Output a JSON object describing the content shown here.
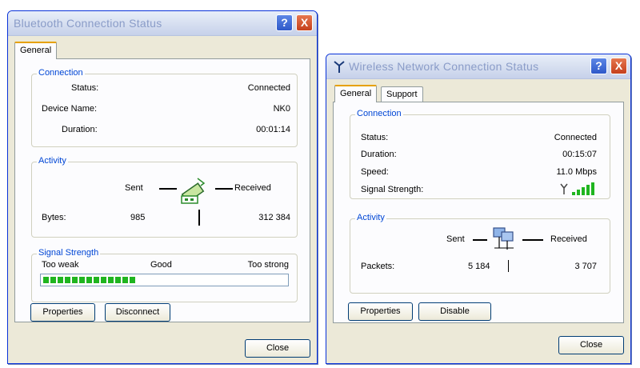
{
  "bt": {
    "title": "Bluetooth Connection Status",
    "tab_general": "General",
    "connection_label": "Connection",
    "status_label": "Status:",
    "status_value": "Connected",
    "device_label": "Device Name:",
    "device_value": "NK0",
    "duration_label": "Duration:",
    "duration_value": "00:01:14",
    "activity_label": "Activity",
    "sent_label": "Sent",
    "received_label": "Received",
    "bytes_label": "Bytes:",
    "bytes_sent": "985",
    "bytes_received": "312 384",
    "signal_group_label": "Signal Strength",
    "too_weak": "Too weak",
    "good": "Good",
    "too_strong": "Too strong",
    "signal_level": 0.38,
    "properties_btn": "Properties",
    "disconnect_btn": "Disconnect",
    "close_btn": "Close"
  },
  "wl": {
    "title": "Wireless Network Connection Status",
    "tab_general": "General",
    "tab_support": "Support",
    "connection_label": "Connection",
    "status_label": "Status:",
    "status_value": "Connected",
    "duration_label": "Duration:",
    "duration_value": "00:15:07",
    "speed_label": "Speed:",
    "speed_value": "11.0 Mbps",
    "signal_label": "Signal Strength:",
    "signal_bars": 5,
    "activity_label": "Activity",
    "sent_label": "Sent",
    "received_label": "Received",
    "packets_label": "Packets:",
    "packets_sent": "5 184",
    "packets_received": "3 707",
    "properties_btn": "Properties",
    "disable_btn": "Disable",
    "close_btn": "Close"
  },
  "icons": {
    "help": "?",
    "close": "X"
  },
  "colors": {
    "group_label": "#0046d5",
    "signal_green": "#1fb51f",
    "window_face": "#ece9d8"
  }
}
